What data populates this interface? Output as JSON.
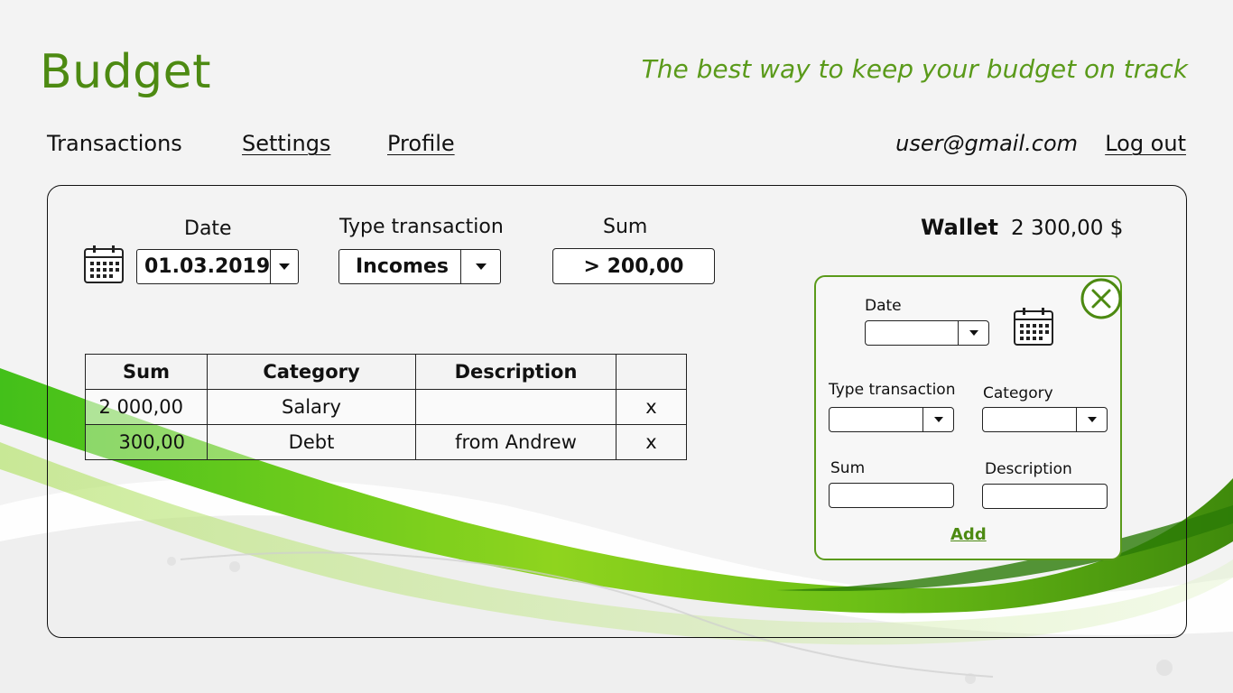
{
  "header": {
    "title": "Budget",
    "tagline": "The best way to keep your budget on track"
  },
  "nav": {
    "items": [
      "Transactions",
      "Settings",
      "Profile"
    ],
    "user_email": "user@gmail.com",
    "logout": "Log out"
  },
  "filters": {
    "date_label": "Date",
    "date_value": "01.03.2019",
    "type_label": "Type transaction",
    "type_value": "Incomes",
    "sum_label": "Sum",
    "sum_value": "> 200,00"
  },
  "table": {
    "headers": [
      "Sum",
      "Category",
      "Description",
      ""
    ],
    "rows": [
      {
        "sum": "2 000,00",
        "category": "Salary",
        "description": "",
        "action": "x"
      },
      {
        "sum": "300,00",
        "category": "Debt",
        "description": "from Andrew",
        "action": "x"
      }
    ]
  },
  "wallet": {
    "label": "Wallet",
    "value": "2 300,00 $"
  },
  "add_form": {
    "date_label": "Date",
    "type_label": "Type transaction",
    "category_label": "Category",
    "sum_label": "Sum",
    "description_label": "Description",
    "add_label": "Add"
  },
  "colors": {
    "accent": "#4d8a12",
    "accent_light": "#6bc11e",
    "background": "#f3f3f3"
  },
  "icons": [
    "calendar-icon",
    "calendar-icon",
    "close-circle-icon",
    "dropdown-arrow-icon"
  ]
}
